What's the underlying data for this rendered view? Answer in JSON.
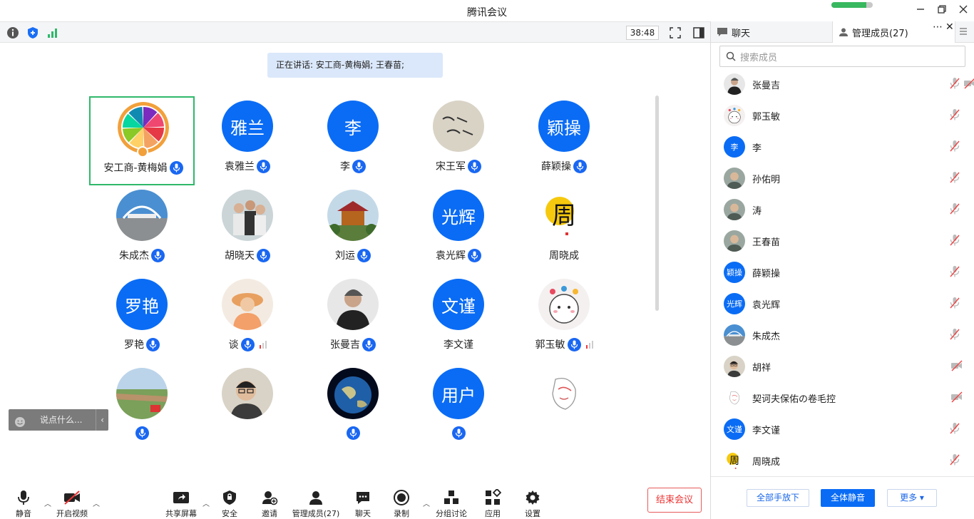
{
  "window": {
    "title": "腾讯会议",
    "timer": "38:48"
  },
  "speaking": {
    "label": "正在讲话: 安工商-黄梅娟; 王春苗;"
  },
  "chat_input": {
    "placeholder": "说点什么..."
  },
  "colors": {
    "accent": "#0a6cf5",
    "active_border": "#2fb86a",
    "danger": "#e33333",
    "signal": "#38b85f"
  },
  "network_level": 0.85,
  "participants": [
    {
      "name": "安工商-黄梅娟",
      "avatar": "fruit",
      "mic": true,
      "active": true
    },
    {
      "name": "袁雅兰",
      "avatar_text": "雅兰",
      "mic": true
    },
    {
      "name": "李",
      "avatar_text": "李",
      "mic": true
    },
    {
      "name": "宋王军",
      "avatar": "calligraphy",
      "mic": true
    },
    {
      "name": "薛颖操",
      "avatar_text": "颖操",
      "mic": true
    },
    {
      "name": "朱成杰",
      "avatar": "landscape",
      "mic": true
    },
    {
      "name": "胡晓天",
      "avatar": "people",
      "mic": true
    },
    {
      "name": "刘运",
      "avatar": "pavilion",
      "mic": true
    },
    {
      "name": "袁光辉",
      "avatar_text": "光辉",
      "mic": true
    },
    {
      "name": "周晓成",
      "avatar": "calligraphy2",
      "mic": false
    },
    {
      "name": "罗艳",
      "avatar_text": "罗艳",
      "mic": true
    },
    {
      "name": "谈",
      "avatar": "hat",
      "mic": true,
      "signal": true
    },
    {
      "name": "张曼吉",
      "avatar": "person-dark",
      "mic": true
    },
    {
      "name": "李文谨",
      "avatar_text": "文谨",
      "mic": false
    },
    {
      "name": "郭玉敏",
      "avatar": "cartoon",
      "mic": true,
      "signal": true
    },
    {
      "avatar": "field",
      "mic": true
    },
    {
      "avatar": "person-glasses",
      "mic": false
    },
    {
      "avatar": "earth",
      "mic": true
    },
    {
      "avatar_text": "用户",
      "mic": true
    },
    {
      "avatar": "sketch",
      "mic": false
    }
  ],
  "panel": {
    "tab_chat": "聊天",
    "tab_members": "管理成员(27)",
    "search_placeholder": "搜索成员",
    "members": [
      {
        "name": "张曼吉",
        "avatar": "photo",
        "video_off": true
      },
      {
        "name": "郭玉敏",
        "avatar": "photo"
      },
      {
        "name": "李",
        "avatar_text": "李"
      },
      {
        "name": "孙佑明",
        "avatar": "photo"
      },
      {
        "name": "涛",
        "avatar": "photo"
      },
      {
        "name": "王春苗",
        "avatar": "photo"
      },
      {
        "name": "薛颖操",
        "avatar_text": "颖操"
      },
      {
        "name": "袁光辉",
        "avatar_text": "光辉"
      },
      {
        "name": "朱成杰",
        "avatar": "photo"
      },
      {
        "name": "胡祥",
        "avatar": "photo",
        "video_off_only": true
      },
      {
        "name": "契诃夫保佑の卷毛控",
        "avatar": "photo",
        "video_off_only": true
      },
      {
        "name": "李文谨",
        "avatar_text": "文谨"
      },
      {
        "name": "周晓成",
        "avatar": "photo"
      }
    ],
    "footer": {
      "raise_down": "全部手放下",
      "mute_all": "全体静音",
      "more": "更多"
    }
  },
  "bottom_bar": {
    "mute": "静音",
    "video": "开启视频",
    "share": "共享屏幕",
    "security": "安全",
    "invite": "邀请",
    "members": "管理成员(27)",
    "chat": "聊天",
    "record": "录制",
    "breakout": "分组讨论",
    "apps": "应用",
    "settings": "设置",
    "end": "结束会议"
  }
}
